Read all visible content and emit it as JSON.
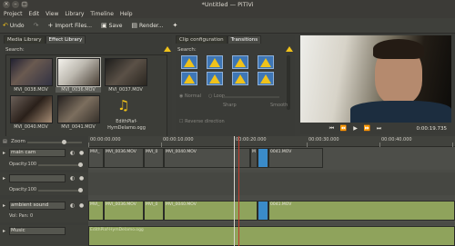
{
  "window": {
    "title": "*Untitled — PiTiVi"
  },
  "menu": [
    "Project",
    "Edit",
    "View",
    "Library",
    "Timeline",
    "Help"
  ],
  "toolbar": {
    "undo": "Undo",
    "import": "Import Files...",
    "save": "Save",
    "render": "Render..."
  },
  "media_library": {
    "tabs": [
      "Media Library",
      "Effect Library"
    ],
    "search_label": "Search:",
    "clips": [
      {
        "label": "MVI_0038.MOV"
      },
      {
        "label": "MVI_0036.MOV"
      },
      {
        "label": "MVI_0037.MOV"
      },
      {
        "label": "MVI_0040.MOV"
      },
      {
        "label": "MVI_0041.MOV"
      },
      {
        "label": "EdithPiaf-HymDelamo.ogg"
      }
    ]
  },
  "clip_panel": {
    "tabs": [
      "Clip configuration",
      "Transitions"
    ],
    "search_label": "Search:",
    "normal": "Normal",
    "loop": "Loop",
    "sharp": "Sharp",
    "smooth": "Smooth",
    "reverse": "Reverse direction"
  },
  "viewer": {
    "timecode": "0:00:19.735"
  },
  "timeline": {
    "zoom_label": "Zoom",
    "ruler_labels": [
      "00:00:00.000",
      "00:00:10.000",
      "00:00:20.000",
      "00:00:30.000",
      "00:00:40.000"
    ],
    "tracks": [
      {
        "name": "main cam",
        "opacity_label": "Opacity:100"
      },
      {
        "name": "",
        "opacity_label": "Opacity:100"
      },
      {
        "name": "ambient sound",
        "sub_label": "Vol:   Pan:   0"
      },
      {
        "name": "Music",
        "sub_label": ""
      }
    ],
    "video1_clips": [
      "MVI_",
      "MVI_0036.MOV",
      "MVI_0",
      "MVI_0040.MOV",
      "M",
      "0041.MOV"
    ],
    "audio1_clips": [
      "MVI_",
      "MVI_0036.MOV",
      "MVI_0",
      "MVI_0040.MOV",
      "0041.MOV"
    ],
    "music_clip": "EdithPiaf-HymDelamo.ogg"
  },
  "colors": {
    "audio_clip": "#8fa35c",
    "selected_clip": "#3a8bc9",
    "effect_icon": "#3e76b5"
  }
}
